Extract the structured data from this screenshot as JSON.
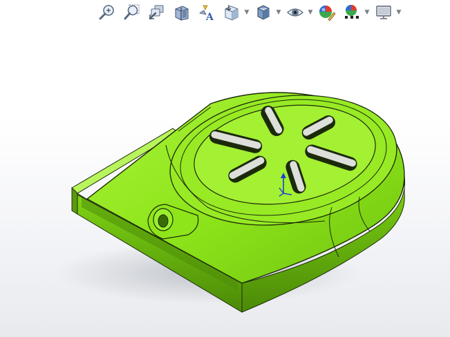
{
  "colors": {
    "part_body": "#8ee51a",
    "part_shadow": "#5fa60b",
    "part_dark": "#3f7506",
    "part_highlight": "#c8ff7a",
    "edge": "#1d2a0a",
    "triad_blue": "#1f3fd0"
  },
  "heads_up_toolbar": {
    "buttons": [
      {
        "name": "zoom-to-fit",
        "icon": "zoom-fit-icon"
      },
      {
        "name": "zoom-to-area",
        "icon": "zoom-area-icon"
      },
      {
        "name": "previous-view",
        "icon": "previous-view-icon"
      },
      {
        "name": "section-view",
        "icon": "section-view-icon"
      },
      {
        "name": "dynamic-annotation-views",
        "icon": "annotation-view-icon"
      },
      {
        "name": "view-orientation",
        "icon": "view-orientation-icon",
        "dropdown": true
      },
      {
        "name": "display-style",
        "icon": "display-style-icon",
        "dropdown": true
      },
      {
        "name": "hide-show-items",
        "icon": "eye-icon",
        "dropdown": true
      },
      {
        "name": "edit-appearance",
        "icon": "edit-appearance-icon"
      },
      {
        "name": "apply-scene",
        "icon": "apply-scene-icon",
        "dropdown": true
      },
      {
        "name": "view-settings",
        "icon": "monitor-icon",
        "dropdown": true
      }
    ]
  }
}
